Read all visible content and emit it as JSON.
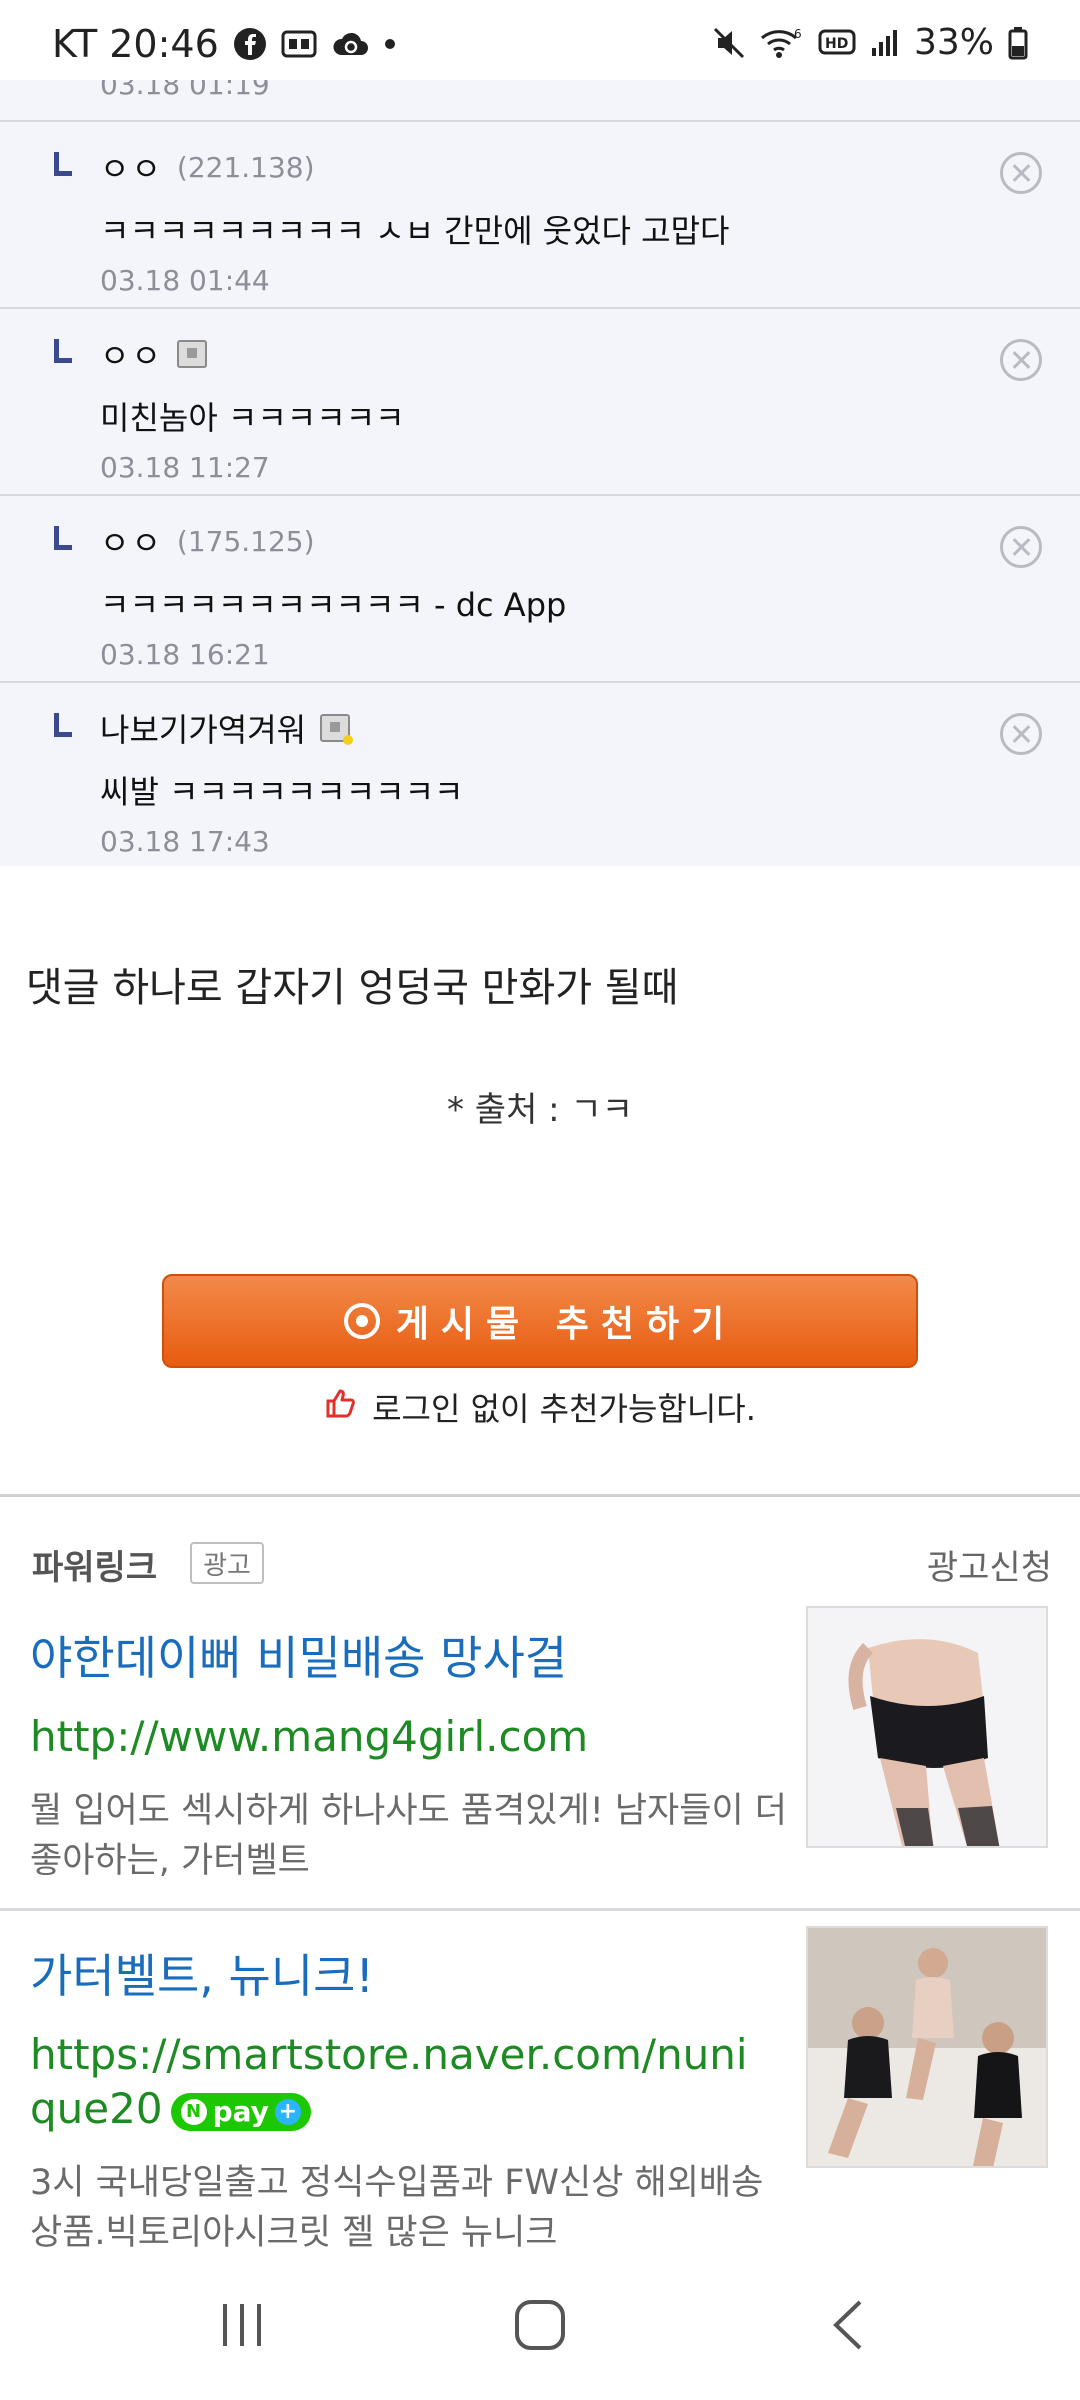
{
  "status_bar": {
    "carrier_time": "KT 20:46",
    "battery": "33%",
    "icons_left": [
      "facebook-icon",
      "sim-card-icon",
      "cloud-sync-icon",
      "dot-icon"
    ],
    "icons_right": [
      "mute-icon",
      "wifi-6-icon",
      "hd-icon",
      "signal-icon",
      "battery-icon"
    ]
  },
  "comments": {
    "top_partial_date": "03.18 01:19",
    "items": [
      {
        "name": "ㅇㅇ",
        "ip": "(221.138)",
        "text": "ㅋㅋㅋㅋㅋㅋㅋㅋㅋ ㅅㅂ 간만에 웃었다 고맙다",
        "date": "03.18 01:44"
      },
      {
        "name": "ㅇㅇ",
        "ip": "",
        "text": "미친놈아 ㅋㅋㅋㅋㅋㅋ",
        "date": "03.18 11:27"
      },
      {
        "name": "ㅇㅇ",
        "ip": "(175.125)",
        "text": "ㅋㅋㅋㅋㅋㅋㅋㅋㅋㅋㅋ - dc App",
        "date": "03.18 16:21"
      },
      {
        "name": "나보기가역겨워",
        "ip": "",
        "text": "씨발 ㅋㅋㅋㅋㅋㅋㅋㅋㅋㅋ",
        "date": "03.18 17:43"
      }
    ]
  },
  "post": {
    "title": "댓글 하나로 갑자기 엉덩국 만화가 될때",
    "source": "* 출처 : ㄱㅋ"
  },
  "recommend": {
    "button_label": "게시물 추천하기",
    "note": "로그인 없이 추천가능합니다."
  },
  "powerlink": {
    "title": "파워링크",
    "ad_badge": "광고",
    "apply": "광고신청",
    "ads": [
      {
        "title": "야한데이뻐 비밀배송 망사걸",
        "url": "http://www.mang4girl.com",
        "desc": "뭘 입어도 섹시하게 하나사도 품격있게! 남자들이 더 좋아하는, 가터벨트"
      },
      {
        "title": "가터벨트, 뉴니크!",
        "url": "https://smartstore.naver.com/nunique20",
        "npay": "pay",
        "desc": "3시 국내당일출고 정식수입품과 FW신상 해외배송상품.빅토리아시크릿 젤 많은 뉴니크"
      }
    ]
  },
  "colors": {
    "comment_bg": "#f3f5fa",
    "ad_title": "#1a6dbd",
    "ad_url": "#1e8a23",
    "recommend_button": "#e85c10"
  }
}
